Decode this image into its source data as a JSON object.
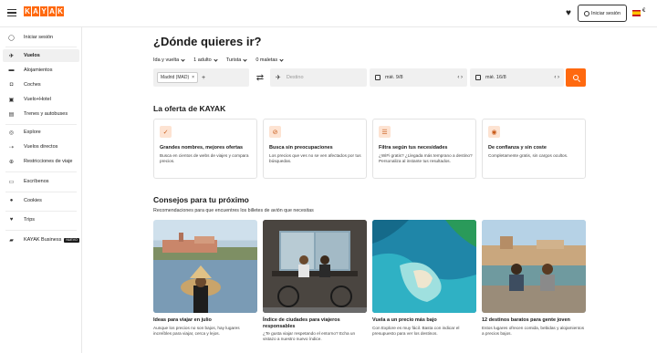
{
  "header": {
    "logo_letters": [
      "K",
      "A",
      "Y",
      "A",
      "K"
    ],
    "login_label": "Iniciar sesión",
    "currency": "€"
  },
  "sidebar": {
    "items": [
      {
        "label": "Iniciar sesión",
        "icon": "user-circle-icon"
      },
      {
        "label": "Vuelos",
        "icon": "plane-icon",
        "active": true
      },
      {
        "label": "Alojamientos",
        "icon": "bed-icon"
      },
      {
        "label": "Coches",
        "icon": "car-icon"
      },
      {
        "label": "Vuelo+Hotel",
        "icon": "suitcase-icon"
      },
      {
        "label": "Trenes y autobuses",
        "icon": "train-icon"
      },
      {
        "label": "Explore",
        "icon": "compass-icon"
      },
      {
        "label": "Vuelos directos",
        "icon": "direct-flight-icon"
      },
      {
        "label": "Restricciones de viaje",
        "icon": "globe-icon"
      },
      {
        "label": "Escríbenos",
        "icon": "chat-icon"
      },
      {
        "label": "Cookies",
        "icon": "cookie-icon"
      },
      {
        "label": "Trips",
        "icon": "heart-icon"
      },
      {
        "label": "KAYAK Business",
        "icon": "briefcase-icon",
        "badge": "NUEVO"
      }
    ]
  },
  "search": {
    "title": "¿Dónde quieres ir?",
    "options": [
      "Ida y vuelta",
      "1 adulto",
      "Turista",
      "0 maletas"
    ],
    "origin_chip": "Madrid (MAD)",
    "destination_placeholder": "Destino",
    "depart_date": "mié. 9/8",
    "return_date": "mié. 16/8"
  },
  "offers": {
    "title": "La oferta de KAYAK",
    "cards": [
      {
        "title": "Grandes nombres, mejores ofertas",
        "desc": "Busca en cientos de webs de viajes y compara precios.",
        "icon": "thumbs-up-icon"
      },
      {
        "title": "Busca sin preocupaciones",
        "desc": "Los precios que ves no se ven afectados por tus búsquedas.",
        "icon": "check-circle-icon"
      },
      {
        "title": "Filtra según tus necesidades",
        "desc": "¿WiFi gratis? ¿Llegada más temprano a destino? Personaliza al instante tus resultados.",
        "icon": "sliders-icon"
      },
      {
        "title": "De confianza y sin coste",
        "desc": "Completamente gratis, sin cargos ocultos.",
        "icon": "location-pin-icon"
      }
    ]
  },
  "tips": {
    "title": "Consejos para tu próximo",
    "subtitle": "Recomendaciones para que encuentres los billetes de avión que necesitas",
    "cards": [
      {
        "title": "Ideas para viajar en julio",
        "desc": "Aunque los precios no son bajos, hay lugares increíbles para viajar, cerca y lejos."
      },
      {
        "title": "Índice de ciudades para viajeros responsables",
        "desc": "¿Te gusta viajar respetando el entorno? Echa un vistazo a nuestro nuevo índice."
      },
      {
        "title": "Vuela a un precio más bajo",
        "desc": "Con Explore es muy fácil. Basta con indicar el presupuesto para ver los destinos."
      },
      {
        "title": "12 destinos baratos para gente joven",
        "desc": "Estos lugares ofrecen comida, bebidas y alojamientos a precios bajos."
      }
    ]
  }
}
